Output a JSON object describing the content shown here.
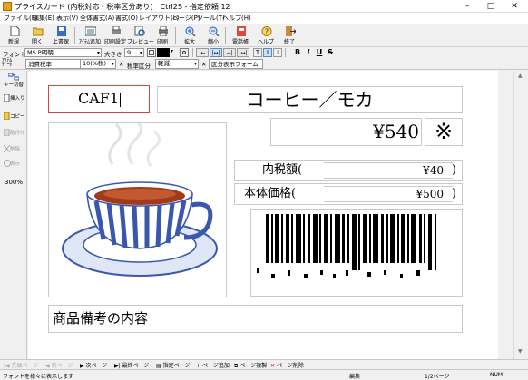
{
  "window": {
    "title": "プライスカード (内税対応・税率区分あり)　Ctrl2S - 指定依頼 12",
    "minimize": "–",
    "maximize": "□",
    "close": "✕"
  },
  "menu": [
    "ファイル(F)",
    "編集(E)",
    "表示(V)",
    "全体書式(A)",
    "書式(O)",
    "レイアウト(L)",
    "ページ(P)",
    "ツール(T)",
    "ヘルプ(H)"
  ],
  "toolbar": {
    "buttons": [
      "新規",
      "開く",
      "上書保",
      "ｱｲﾃﾑ追加",
      "印刷設定",
      "プレビュー",
      "印刷",
      "拡大",
      "縮小",
      "電話帳",
      "ヘルプ",
      "終了"
    ]
  },
  "format": {
    "font_label": "フォント名",
    "font_value": "MS P明朝",
    "size_label": "大きさ",
    "size_value": "9"
  },
  "tax": {
    "rate_label": "消費税率",
    "rate_value": "10(%税)",
    "class_label": "税率区分",
    "class_value": "軽減",
    "form_label": "区分表示フォーム"
  },
  "sidebar": {
    "items": [
      "キー切替",
      "挿入り",
      "コピー",
      "貼付け",
      "削除",
      "表示"
    ],
    "zoom": "300%",
    "top_labels": [
      "ｱｲﾃﾑ",
      "ﾃﾞｰﾀ"
    ]
  },
  "card": {
    "code": "CAF1",
    "product_name": "コーヒー／モカ",
    "price": "¥540",
    "mark": "※",
    "tax_incl_label": "内税額(",
    "tax_incl_value": "¥40",
    "base_label": "本体価格(",
    "base_value": "¥500",
    "close_paren": ")",
    "remarks": "商品備考の内容"
  },
  "nav": {
    "first": "先頭ページ",
    "prev": "前ページ",
    "next": "次ページ",
    "last": "最終ページ",
    "specify": "指定ページ",
    "add": "ページ追加",
    "copy": "ページ複製",
    "delete": "ページ削除"
  },
  "status": {
    "hint": "フォントを様々に表示します",
    "mode": "編集",
    "page": "1/2ページ",
    "num": "NUM"
  },
  "colors": {
    "code_border": "#e04040",
    "barcode": "#000000",
    "cup_stripe": "#3a57b0",
    "coffee": "#a03a1a"
  }
}
